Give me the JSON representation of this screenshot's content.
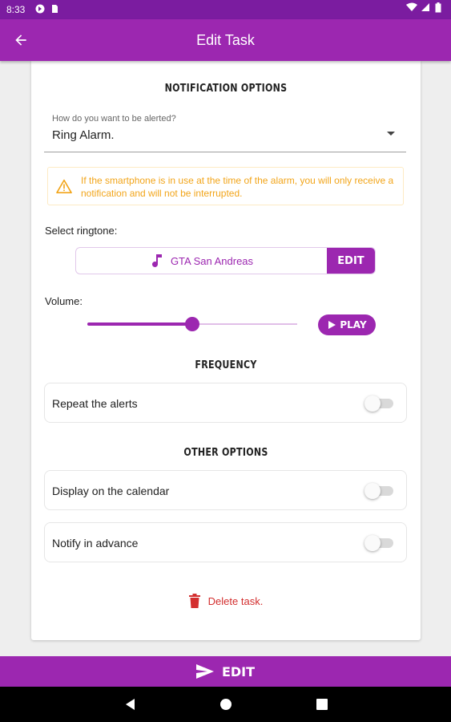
{
  "status_bar": {
    "time": "8:33",
    "left_icons": [
      "app-notification-icon",
      "sim-card-icon"
    ],
    "right_icons": [
      "wifi-icon",
      "signal-icon",
      "battery-icon"
    ]
  },
  "app_bar": {
    "title": "Edit Task",
    "back_icon": "arrow-back-icon"
  },
  "notification_options": {
    "section_title": "NOTIFICATION OPTIONS",
    "alert_select": {
      "label": "How do you want to be alerted?",
      "value": "Ring Alarm."
    },
    "warning_text": "If the smartphone is in use at the time of the alarm, you will only receive a notification and will not be interrupted.",
    "ringtone_label": "Select ringtone:",
    "ringtone_name": "GTA San Andreas",
    "ringtone_edit_label": "EDIT",
    "volume_label": "Volume:",
    "volume_level": 0.5,
    "play_label": "PLAY"
  },
  "frequency": {
    "section_title": "FREQUENCY",
    "repeat_label": "Repeat the alerts",
    "repeat_on": false
  },
  "other_options": {
    "section_title": "OTHER OPTIONS",
    "calendar_label": "Display on the calendar",
    "calendar_on": false,
    "advance_label": "Notify in advance",
    "advance_on": false
  },
  "delete_label": "Delete task.",
  "bottom_button_label": "EDIT",
  "colors": {
    "primary": "#9c27b0",
    "status_bar": "#7b1ca0",
    "warning": "#f2a51a",
    "danger": "#d32f2f"
  },
  "nav_bar": {
    "icons": [
      "back-triangle-icon",
      "home-circle-icon",
      "recents-square-icon"
    ]
  }
}
